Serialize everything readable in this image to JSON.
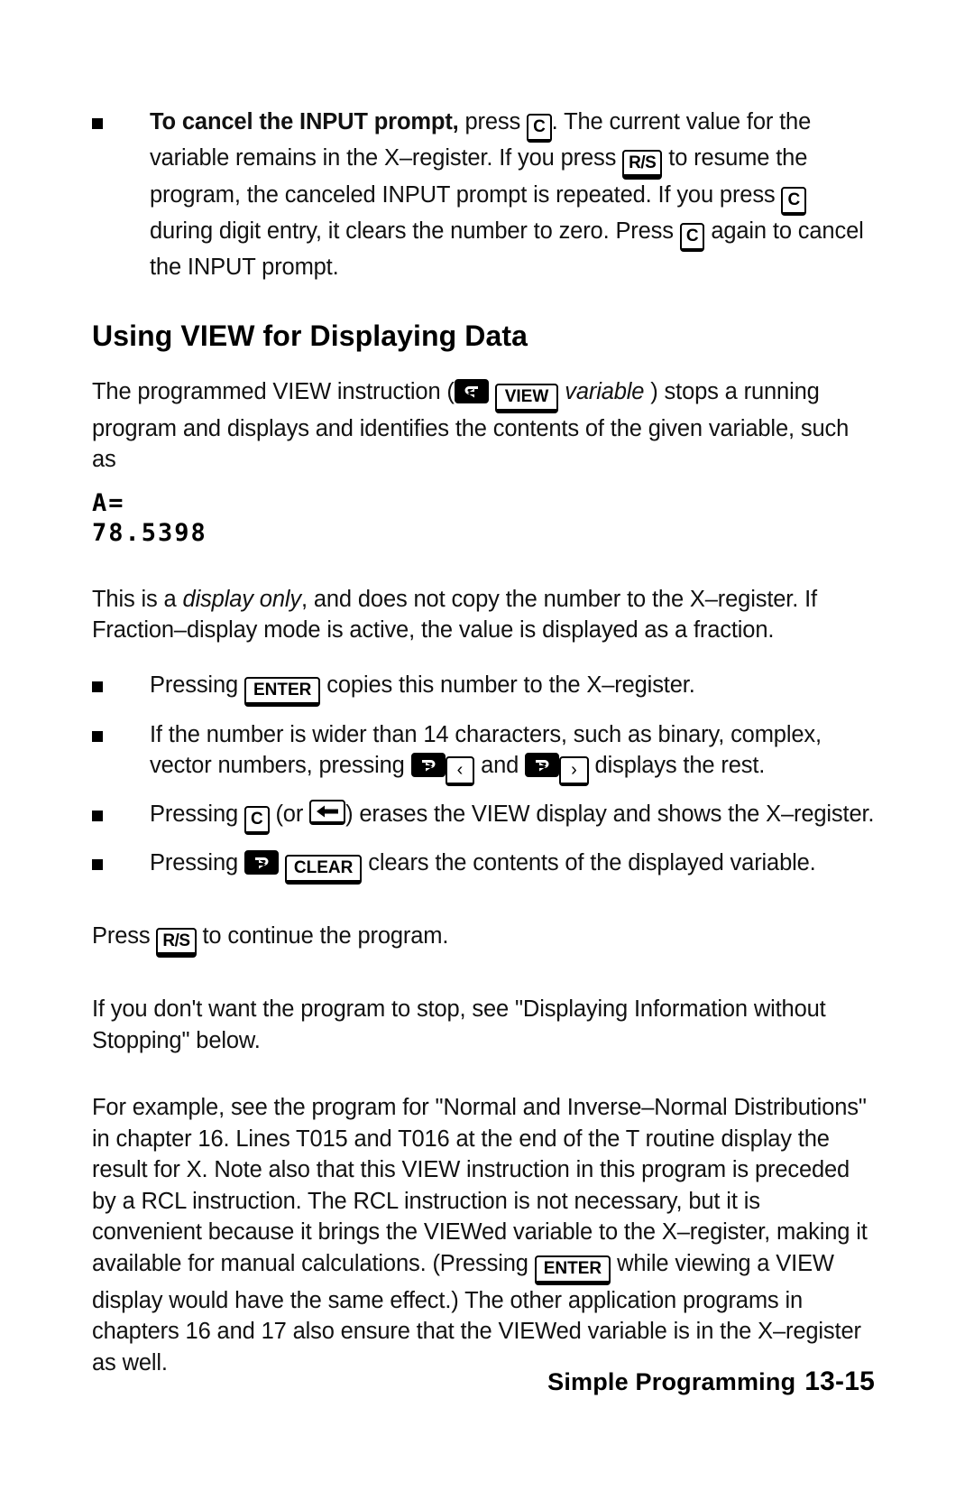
{
  "page": {
    "footer_title": "Simple Programming",
    "footer_page": "13-15"
  },
  "cancel_bullet": {
    "lead": "To cancel the INPUT prompt,",
    "t1": " press ",
    "key1": "C",
    "t2": ". The current value for the variable remains in the X–register. If you press ",
    "key2": "R/S",
    "t3": " to resume the program, the canceled INPUT prompt is repeated. If you press ",
    "key3": "C",
    "t4": " during digit entry, it clears the number to zero. Press ",
    "key4": "C",
    "t5": " again to cancel the INPUT prompt."
  },
  "heading": "Using VIEW for Displaying Data",
  "intro": {
    "t1": "The programmed VIEW instruction (",
    "shift_icon": "left-shift-icon",
    "key_view": "VIEW",
    "italic": "variable",
    "t2": " ) stops a running program and displays and identifies the contents of the given variable, such as"
  },
  "display": {
    "line1": "A=",
    "line2": "78.5398"
  },
  "after_display": {
    "t1": "This is a ",
    "italic": "display only",
    "t2": ", and does not copy the number to the X–register. If Fraction–display mode is active, the value is displayed as a fraction."
  },
  "bullets": [
    {
      "t1": "Pressing ",
      "key1": "ENTER",
      "t2": " copies this number to the X–register."
    },
    {
      "t1": "If the number is wider than 14 characters, such as binary, complex, vector numbers, pressing ",
      "shift1": "right-shift-icon",
      "key1": "‹",
      "t2": " and ",
      "shift2": "right-shift-icon",
      "key2": "›",
      "t3": " displays the rest."
    },
    {
      "t1": "Pressing ",
      "key1": "C",
      "t2": " (or ",
      "key2": "backspace-icon",
      "t3": ") erases the VIEW display and shows the X–register."
    },
    {
      "t1": "Pressing ",
      "shift1": "right-shift-icon",
      "key1": "CLEAR",
      "t2": " clears the contents of the displayed variable."
    }
  ],
  "press_rs": {
    "t1": "Press ",
    "key1": "R/S",
    "t2": " to continue the program."
  },
  "stop_para": "If you don't want the program to stop, see \"Displaying Information without Stopping\" below.",
  "example_para": {
    "t1": "For example, see the program for \"Normal and Inverse–Normal Distributions\" in chapter 16. Lines T015 and T016 at the end of the T routine display the result for X. Note also that this VIEW instruction in this program is preceded by a RCL instruction. The RCL instruction is not necessary, but it is convenient because it brings the VIEWed variable to the X–register, making it available for manual calculations. (Pressing ",
    "key1": "ENTER",
    "t2": " while viewing a VIEW display would have the same effect.) The other application programs in chapters 16 and 17 also ensure that the VIEWed variable is in the X–register as well."
  }
}
